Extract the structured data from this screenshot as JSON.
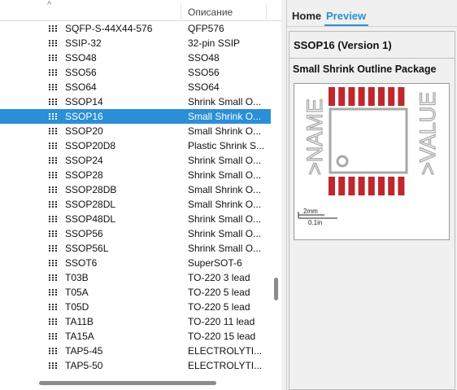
{
  "list": {
    "sort_indicator": "^",
    "description_header": "Описание",
    "rows": [
      {
        "name": "SQFP-S-44X44-576",
        "desc": "QFP576",
        "selected": false
      },
      {
        "name": "SSIP-32",
        "desc": "32-pin SSIP",
        "selected": false
      },
      {
        "name": "SSO48",
        "desc": "SSO48",
        "selected": false
      },
      {
        "name": "SSO56",
        "desc": "SSO56",
        "selected": false
      },
      {
        "name": "SSO64",
        "desc": "SSO64",
        "selected": false
      },
      {
        "name": "SSOP14",
        "desc": "Shrink Small O...",
        "selected": false
      },
      {
        "name": "SSOP16",
        "desc": "Small Shrink O...",
        "selected": true
      },
      {
        "name": "SSOP20",
        "desc": "Small Shrink O...",
        "selected": false
      },
      {
        "name": "SSOP20D8",
        "desc": "Plastic Shrink S...",
        "selected": false
      },
      {
        "name": "SSOP24",
        "desc": "Shrink Small O...",
        "selected": false
      },
      {
        "name": "SSOP28",
        "desc": "Shrink Small O...",
        "selected": false
      },
      {
        "name": "SSOP28DB",
        "desc": "Small Shrink O...",
        "selected": false
      },
      {
        "name": "SSOP28DL",
        "desc": "Small Shrink O...",
        "selected": false
      },
      {
        "name": "SSOP48DL",
        "desc": "Shrink Small O...",
        "selected": false
      },
      {
        "name": "SSOP56",
        "desc": "Shrink Small O...",
        "selected": false
      },
      {
        "name": "SSOP56L",
        "desc": "Shrink Small O...",
        "selected": false
      },
      {
        "name": "SSOT6",
        "desc": "SuperSOT-6",
        "selected": false
      },
      {
        "name": "T03B",
        "desc": "TO-220 3 lead",
        "selected": false
      },
      {
        "name": "T05A",
        "desc": "TO-220 5 lead",
        "selected": false
      },
      {
        "name": "T05D",
        "desc": "TO-220 5 lead",
        "selected": false
      },
      {
        "name": "TA11B",
        "desc": "TO-220 11 lead",
        "selected": false
      },
      {
        "name": "TA15A",
        "desc": "TO-220 15 lead",
        "selected": false
      },
      {
        "name": "TAP5-45",
        "desc": "ELECTROLYTI...",
        "selected": false
      },
      {
        "name": "TAP5-50",
        "desc": "ELECTROLYTI...",
        "selected": false
      }
    ]
  },
  "tabs": {
    "home": "Home",
    "preview": "Preview"
  },
  "preview": {
    "package_title": "SSOP16 (Version 1)",
    "package_description": "Small Shrink Outline Package",
    "footprint": {
      "name_label": ">NAME",
      "value_label": ">VALUE",
      "scale_mm": "2mm",
      "scale_in": "0.1in",
      "pads_per_side": 8
    }
  },
  "colors": {
    "selection": "#2a8fd6",
    "tab_active": "#2a8fd6",
    "pad": "#c0272d",
    "silkscreen": "#a8a8a8"
  }
}
